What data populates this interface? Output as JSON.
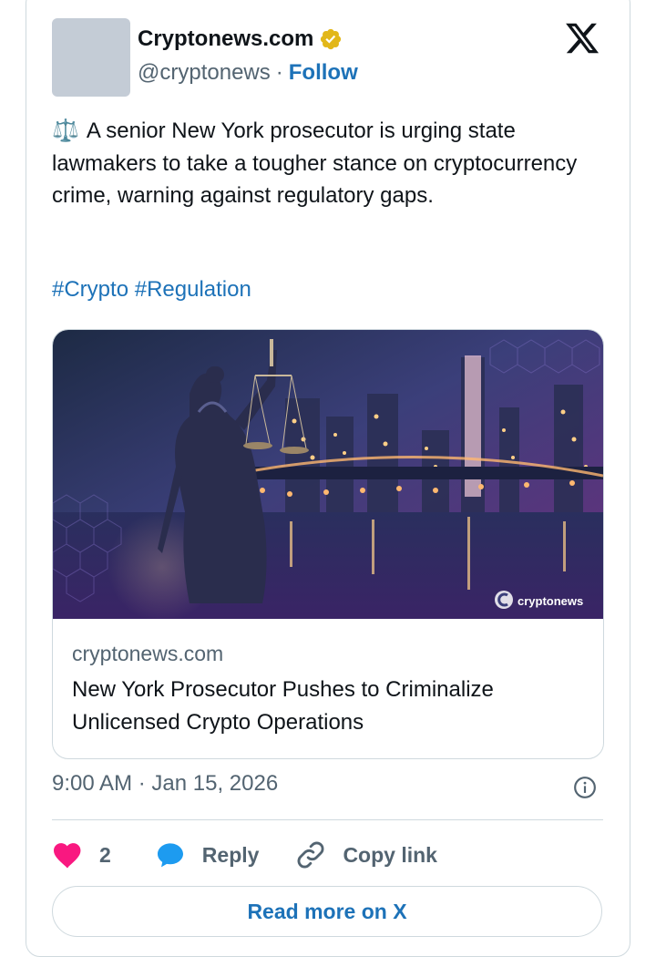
{
  "author": {
    "display_name": "Cryptonews.com",
    "handle": "@cryptonews",
    "separator": "·",
    "follow_label": "Follow"
  },
  "tweet": {
    "emoji": "⚖️",
    "text": "A senior New York prosecutor is urging state lawmakers to take a tougher stance on cryptocurrency crime, warning against regulatory gaps.",
    "hashtags": [
      "#Crypto",
      "#Regulation"
    ]
  },
  "link_card": {
    "image_watermark": "cryptonews",
    "domain": "cryptonews.com",
    "title": "New York Prosecutor Pushes to Criminalize Unlicensed Crypto Operations"
  },
  "meta": {
    "timestamp": "9:00 AM · Jan 15, 2026"
  },
  "actions": {
    "like_count": "2",
    "reply_label": "Reply",
    "copy_link_label": "Copy link"
  },
  "read_more_label": "Read more on X",
  "colors": {
    "link_blue": "#1d72b8",
    "like_pink": "#f91880",
    "reply_blue": "#1d9bf0",
    "verified_gold": "#e2b719",
    "muted_text": "#536471",
    "border": "#cfd9de"
  },
  "icons": [
    "verified-badge-icon",
    "x-logo-icon",
    "info-icon",
    "heart-icon",
    "reply-bubble-icon",
    "link-icon"
  ]
}
